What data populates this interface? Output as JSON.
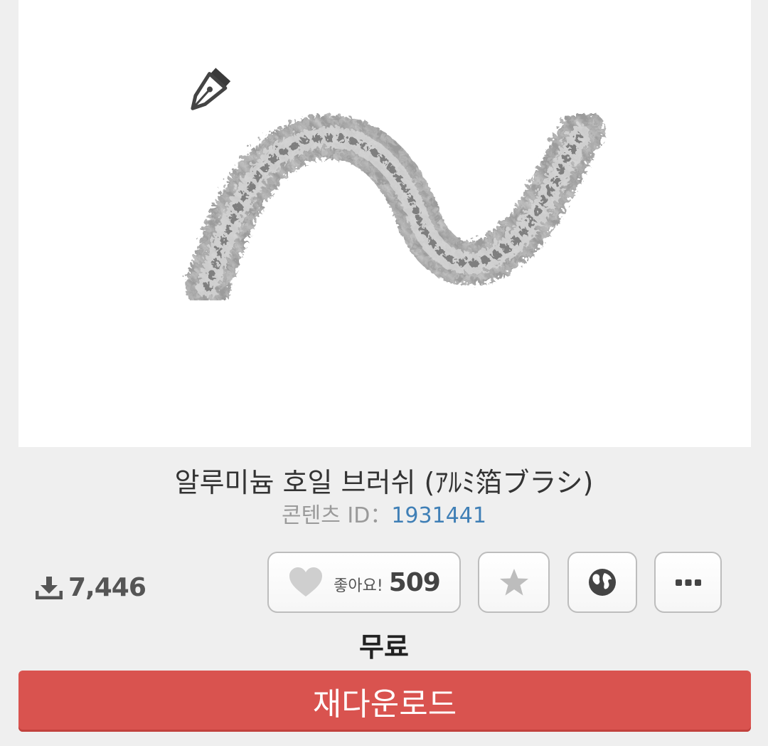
{
  "content": {
    "title": "알루미늄 호일 브러쉬 (ｱﾙﾐ箔ブラシ)",
    "id_label": "콘텐츠 ID：",
    "id_value": "1931441"
  },
  "stats": {
    "download_icon": "download-icon",
    "downloads": "7,446"
  },
  "actions": {
    "like_icon": "heart-icon",
    "like_label": "좋아요!",
    "like_count": "509",
    "favorite_icon": "star-icon",
    "globe_icon": "globe-icon",
    "more_icon": "more-dots-icon"
  },
  "price": "무료",
  "redownload_label": "재다운로드",
  "colors": {
    "accent": "#d9534f",
    "link": "#3f7fb6",
    "background": "#efefef"
  }
}
